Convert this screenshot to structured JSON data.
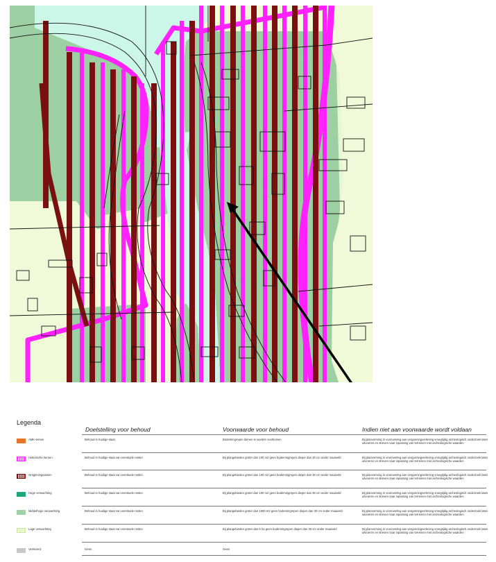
{
  "legend": {
    "title": "Legenda",
    "headers": [
      "Doelstelling voor behoud",
      "Voorwaarde voor behoud",
      "Indien niet aan voorwaarde wordt voldaan"
    ],
    "rows": [
      {
        "name": "AMK-terrein",
        "color": "#e8732a",
        "pattern": "solid",
        "doel": "Behoud in huidige staat",
        "voorwaarde": "Bodemingrepen dienen te worden voorkomen",
        "indien": "Bij planvorming in vooroverleg aan vergunningverlening vroegtijdig archeologisch onderzoek laten uitvoeren en streven naar inpassing van terreinen met archeologische waarden"
      },
      {
        "name": "Historische kernen",
        "color": "#ff33ff",
        "pattern": "hatch",
        "doel": "Behoud in huidige staat van eventuele resten",
        "voorwaarde": "Bij plangebieden groter dan 100 m2 geen bodemingrepen dieper dan 30 cm onder maaiveld",
        "indien": "Bij planvorming in vooroverleg aan vergunningverlening vroegtijdig archeologisch onderzoek laten uitvoeren en streven naar inpassing van terreinen met archeologische waarden"
      },
      {
        "name": "Ontginningsassen",
        "color": "#7a1010",
        "pattern": "hatch",
        "doel": "Behoud in huidige staat van eventuele resten",
        "voorwaarde": "Bij plangebieden groter dan 100 m2 geen bodemingrepen dieper dan 30 cm onder maaiveld",
        "indien": "Bij planvorming in vooroverleg aan vergunningverlening vroegtijdig archeologisch onderzoek laten uitvoeren en streven naar inpassing van terreinen met archeologische waarden"
      },
      {
        "name": "Hoge verwachting",
        "color": "#1aa87a",
        "pattern": "solid",
        "doel": "Behoud in huidige staat van eventuele resten",
        "voorwaarde": "Bij plangebieden groter dan 100 m2 geen bodemingrepen dieper dan 30 cm onder maaiveld",
        "indien": "Bij planvorming in vooroverleg aan vergunningverlening vroegtijdig archeologisch onderzoek laten uitvoeren en streven naar inpassing van terreinen met archeologische waarden"
      },
      {
        "name": "Middelhoge verwachting",
        "color": "#9dd3a4",
        "pattern": "solid",
        "doel": "Behoud in huidige staat van eventuele resten",
        "voorwaarde": "Bij plangebieden groter dan 1000 m2 geen bodemingrepen dieper dan 30 cm onder maaiveld",
        "indien": "Bij planvorming in vooroverleg aan vergunningverlening vroegtijdig archeologisch onderzoek laten uitvoeren en streven naar inpassing van terreinen met archeologische waarden"
      },
      {
        "name": "Lage verwachting",
        "color": "#eaf7cc",
        "pattern": "solid",
        "doel": "Behoud in huidige staat van eventuele resten",
        "voorwaarde": "Bij plangebieden groter dan 5 ha geen bodemingrepen dieper dan 30 cm onder maaiveld",
        "indien": "Bij planvorming in vooroverleg aan vergunningverlening vroegtijdig archeologisch onderzoek laten uitvoeren en streven naar inpassing van terreinen met archeologische waarden"
      },
      {
        "name": "Verstoord",
        "color": "#c8c8c8",
        "pattern": "solid",
        "doel": "Geen",
        "voorwaarde": "Geen",
        "indien": ""
      }
    ]
  },
  "map_colors": {
    "low": "#f0f9d8",
    "mid": "#9ccfa1",
    "water": "#ccf7e8",
    "historic": "#ff22ff",
    "axis": "#7a1010",
    "arrow": "#000000",
    "outline": "#111111"
  }
}
